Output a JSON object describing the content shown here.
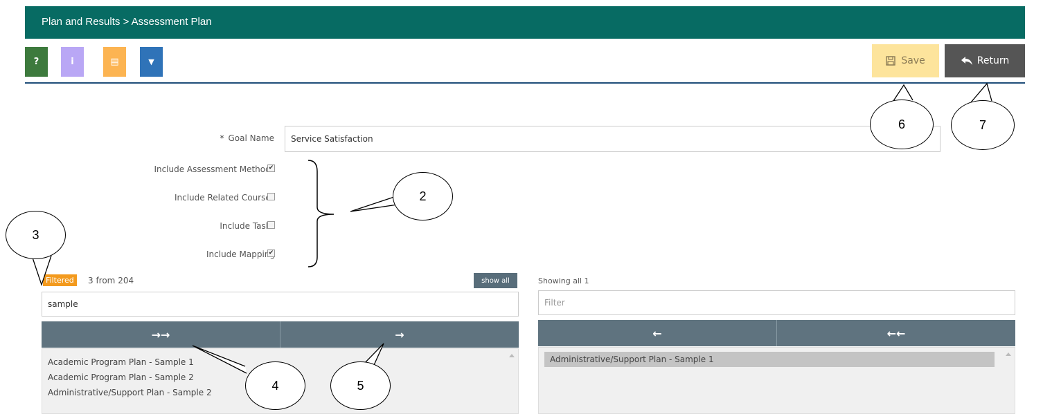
{
  "header": {
    "breadcrumb": "Plan and Results  >  Assessment Plan"
  },
  "toolbar": {
    "buttons": [
      {
        "glyph": "?",
        "color": "#3d7a3d",
        "icon": "help-icon"
      },
      {
        "glyph": "i",
        "color": "#b9a7f5",
        "icon": "info-icon"
      },
      {
        "glyph": "▤",
        "color": "#fcb452",
        "icon": "list-icon"
      },
      {
        "glyph": "▼",
        "color": "#2f73b8",
        "icon": "filter-icon"
      }
    ],
    "save_label": "Save",
    "return_label": "Return"
  },
  "form": {
    "goal_name_label": "Goal Name",
    "goal_name_value": "Service Satisfaction",
    "checkboxes": [
      {
        "label": "Include Assessment Methods",
        "checked": true
      },
      {
        "label": "Include Related Courses",
        "checked": false
      },
      {
        "label": "Include Tasks",
        "checked": false
      },
      {
        "label": "Include Mapping",
        "checked": true
      }
    ]
  },
  "left_panel": {
    "badge": "Filtered",
    "count_text": "3 from 204",
    "show_all_label": "show all",
    "filter_value": "sample",
    "buttons": [
      "→→",
      "→"
    ],
    "items": [
      "Academic Program Plan - Sample 1",
      "Academic Program Plan - Sample 2",
      "Administrative/Support Plan - Sample 2"
    ]
  },
  "right_panel": {
    "showing_text": "Showing all 1",
    "filter_placeholder": "Filter",
    "buttons": [
      "←",
      "←←"
    ],
    "items": [
      "Administrative/Support Plan - Sample 1"
    ]
  },
  "callouts": [
    "2",
    "3",
    "4",
    "5",
    "6",
    "7"
  ]
}
